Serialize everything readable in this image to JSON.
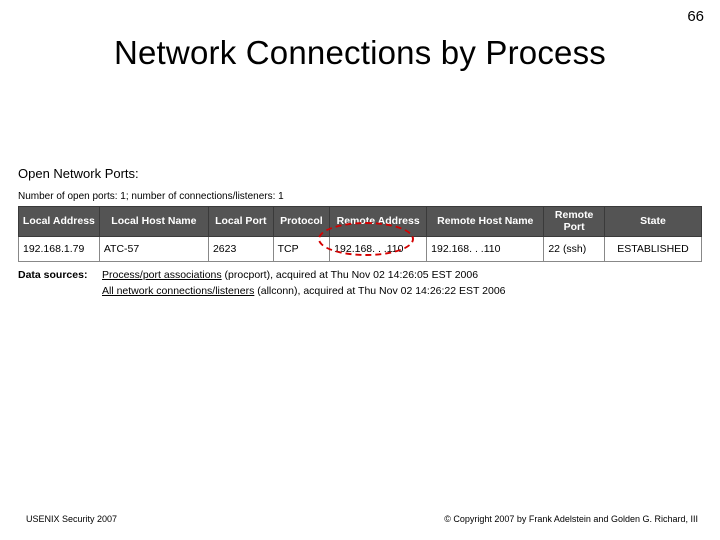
{
  "page_number": "66",
  "title": "Network Connections by Process",
  "section_label": "Open Network Ports:",
  "counts_line": "Number of open ports: 1; number of connections/listeners: 1",
  "table": {
    "headers": {
      "local_address": "Local Address",
      "local_host_name": "Local Host Name",
      "local_port": "Local Port",
      "protocol": "Protocol",
      "remote_address": "Remote Address",
      "remote_host_name": "Remote Host Name",
      "remote_port": "Remote Port",
      "state": "State"
    },
    "row": {
      "local_address": "192.168.1.79",
      "local_host_name": "ATC-57",
      "local_port": "2623",
      "protocol": "TCP",
      "remote_address": "192.168. . .110",
      "remote_host_name": "192.168. . .110",
      "remote_port": "22 (ssh)",
      "state": "ESTABLISHED"
    }
  },
  "sources": {
    "label": "Data sources:",
    "line1_link": "Process/port associations",
    "line1_rest": " (procport),            acquired at Thu Nov 02 14:26:05 EST 2006",
    "line2_link": "All network connections/listeners",
    "line2_rest": " (allconn), acquired at Thu Nov 02 14:26:22 EST 2006"
  },
  "footer": {
    "left": "USENIX Security 2007",
    "right": "© Copyright 2007 by Frank Adelstein and Golden G. Richard, III"
  }
}
